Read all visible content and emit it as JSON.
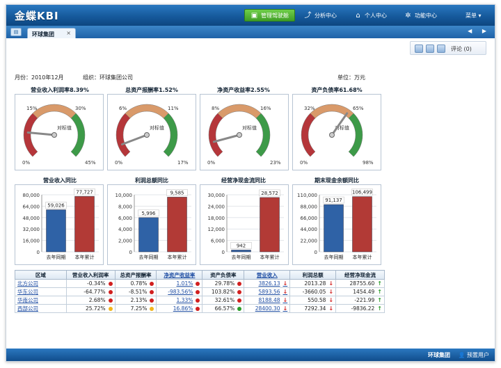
{
  "app": {
    "logo": "金蝶KBI",
    "nav": [
      {
        "label": "管理驾驶舱",
        "icon": "cockpit-icon",
        "active": true
      },
      {
        "label": "分析中心",
        "icon": "chart-line-icon",
        "active": false
      },
      {
        "label": "个人中心",
        "icon": "home-icon",
        "active": false
      },
      {
        "label": "功能中心",
        "icon": "gear-icon",
        "active": false
      },
      {
        "label": "菜单 ▾",
        "icon": "",
        "active": false
      }
    ]
  },
  "tabs": {
    "active": "环球集团",
    "close": "×",
    "arrows": "◀ ▶"
  },
  "toolbar": {
    "comment_label": "评论 (0)"
  },
  "meta": {
    "month": "月份：2010年12月",
    "org": "组织：环球集团公司",
    "unit": "单位：万元"
  },
  "gauges": [
    {
      "title": "营业收入利润率8.39%",
      "ticks": [
        "15%",
        "30%",
        "0%",
        "45%"
      ],
      "value_label": "对标值"
    },
    {
      "title": "总资产报酬率1.52%",
      "ticks": [
        "6%",
        "11%",
        "0%",
        "17%"
      ],
      "value_label": "对标值"
    },
    {
      "title": "净资产收益率2.55%",
      "ticks": [
        "8%",
        "16%",
        "0%",
        "23%"
      ],
      "value_label": "对标值"
    },
    {
      "title": "资产负债率61.68%",
      "ticks": [
        "32%",
        "65%",
        "0%",
        "98%"
      ],
      "value_label": "对标值"
    }
  ],
  "gauge_values": [
    {
      "value": 8.39,
      "max": 45
    },
    {
      "value": 1.52,
      "max": 17
    },
    {
      "value": 2.55,
      "max": 23
    },
    {
      "value": 61.68,
      "max": 98
    }
  ],
  "chart_data": [
    {
      "type": "bar",
      "title": "营业收入同比",
      "categories": [
        "去年同期",
        "本年累计"
      ],
      "values": [
        59026,
        77727
      ],
      "value_labels": [
        "59,026",
        "77,727"
      ],
      "ylim": [
        0,
        80000
      ],
      "yticks": [
        "80,000",
        "64,000",
        "48,000",
        "32,000",
        "16,000",
        "0"
      ],
      "colors": [
        "#2f62a6",
        "#b23a36"
      ]
    },
    {
      "type": "bar",
      "title": "利润总额同比",
      "categories": [
        "去年同期",
        "本年累计"
      ],
      "values": [
        5996,
        9585
      ],
      "value_labels": [
        "5,996",
        "9,585"
      ],
      "ylim": [
        0,
        10000
      ],
      "yticks": [
        "10,000",
        "8,000",
        "6,000",
        "4,000",
        "2,000",
        "0"
      ],
      "colors": [
        "#2f62a6",
        "#b23a36"
      ]
    },
    {
      "type": "bar",
      "title": "经营净现金流同比",
      "categories": [
        "去年同期",
        "本年累计"
      ],
      "values": [
        942,
        28572
      ],
      "value_labels": [
        "942",
        "28,572"
      ],
      "ylim": [
        0,
        30000
      ],
      "yticks": [
        "30,000",
        "24,000",
        "18,000",
        "12,000",
        "6,000",
        "0"
      ],
      "colors": [
        "#2f62a6",
        "#b23a36"
      ]
    },
    {
      "type": "bar",
      "title": "期末现金余额同比",
      "categories": [
        "去年同期",
        "本年累计"
      ],
      "values": [
        91137,
        106499
      ],
      "value_labels": [
        "91,137",
        "106,499"
      ],
      "ylim": [
        0,
        110000
      ],
      "yticks": [
        "110,000",
        "88,000",
        "66,000",
        "44,000",
        "22,000",
        "0"
      ],
      "colors": [
        "#2f62a6",
        "#b23a36"
      ]
    }
  ],
  "table": {
    "headers": [
      "区域",
      "营业收入利润率",
      "总资产报酬率",
      "净资产收益率",
      "资产负债率",
      "营业收入",
      "利润总额",
      "经营净现金流"
    ],
    "rows": [
      {
        "region": "北方公司",
        "c1": "-0.34%",
        "c1s": "#d11f1f",
        "c2": "0.78%",
        "c2s": "#d11f1f",
        "c3": "1.01%",
        "c3s": "#d11f1f",
        "c4": "29.78%",
        "c4s": "#d11f1f",
        "c5": "3826.13",
        "c5a": "↓",
        "c6": "2013.28",
        "c6a": "↓",
        "c7": "28755.60",
        "c7a": "↑"
      },
      {
        "region": "华东公司",
        "c1": "-64.77%",
        "c1s": "#d11f1f",
        "c2": "-8.51%",
        "c2s": "#d11f1f",
        "c3": "-983.56%",
        "c3s": "#d11f1f",
        "c4": "103.82%",
        "c4s": "#d11f1f",
        "c5": "5893.56",
        "c5a": "↓",
        "c6": "-3660.05",
        "c6a": "↓",
        "c7": "1454.49",
        "c7a": "↑"
      },
      {
        "region": "华南公司",
        "c1": "2.68%",
        "c1s": "#d11f1f",
        "c2": "2.13%",
        "c2s": "#d11f1f",
        "c3": "1.33%",
        "c3s": "#d11f1f",
        "c4": "32.61%",
        "c4s": "#d11f1f",
        "c5": "8188.48",
        "c5a": "↓",
        "c6": "550.58",
        "c6a": "↓",
        "c7": "-221.99",
        "c7a": "↑"
      },
      {
        "region": "西部公司",
        "c1": "25.72%",
        "c1s": "#f2b51d",
        "c2": "7.25%",
        "c2s": "#f2b51d",
        "c3": "16.86%",
        "c3s": "#d11f1f",
        "c4": "66.57%",
        "c4s": "#2a9c2a",
        "c5": "28400.30",
        "c5a": "↓",
        "c6": "7292.34",
        "c6a": "↓",
        "c7": "-9836.22",
        "c7a": "↑"
      }
    ]
  },
  "footer": {
    "company": "环球集团",
    "user": "预置用户"
  }
}
